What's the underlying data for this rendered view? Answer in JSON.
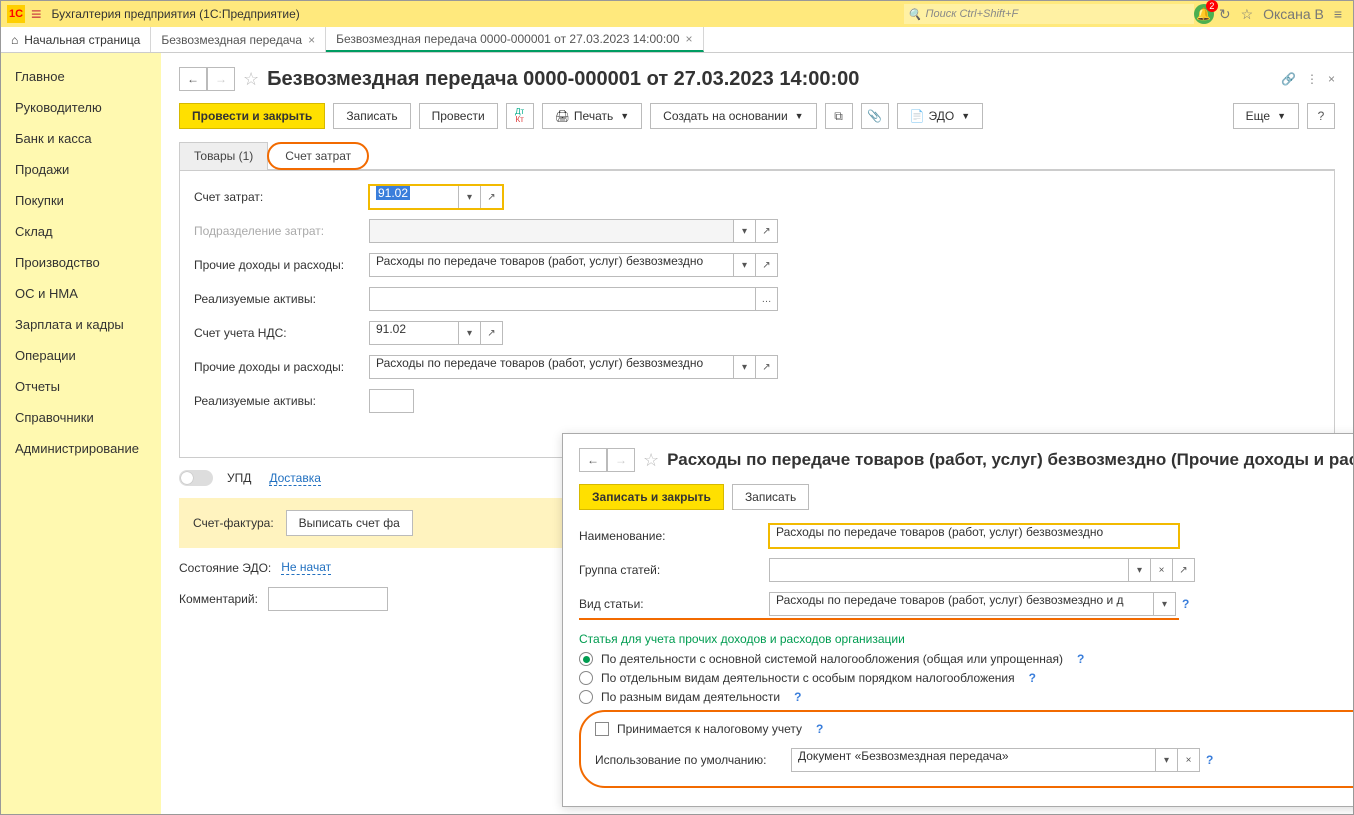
{
  "titlebar": {
    "app_title": "Бухгалтерия предприятия  (1С:Предприятие)",
    "search_placeholder": "Поиск Ctrl+Shift+F",
    "bell_badge": "2",
    "user": "Оксана В"
  },
  "tabs": {
    "home": "Начальная страница",
    "t1": "Безвозмездная передача",
    "t2": "Безвозмездная передача 0000-000001 от 27.03.2023 14:00:00"
  },
  "sidebar": {
    "items": [
      "Главное",
      "Руководителю",
      "Банк и касса",
      "Продажи",
      "Покупки",
      "Склад",
      "Производство",
      "ОС и НМА",
      "Зарплата и кадры",
      "Операции",
      "Отчеты",
      "Справочники",
      "Администрирование"
    ]
  },
  "docheader": {
    "title": "Безвозмездная передача 0000-000001 от 27.03.2023 14:00:00"
  },
  "toolbar": {
    "post_close": "Провести и закрыть",
    "save": "Записать",
    "post": "Провести",
    "print": "Печать",
    "create_based": "Создать на основании",
    "edo": "ЭДО",
    "more": "Еще",
    "help": "?"
  },
  "tabs2": {
    "goods": "Товары (1)",
    "cost": "Счет затрат"
  },
  "form": {
    "l_cost_acc": "Счет затрат:",
    "v_cost_acc": "91.02",
    "l_subdiv": "Подразделение затрат:",
    "l_other": "Прочие доходы и расходы:",
    "v_other": "Расходы по передаче товаров (работ, услуг) безвозмездно",
    "l_assets": "Реализуемые активы:",
    "l_nds": "Счет учета НДС:",
    "v_nds": "91.02"
  },
  "bottom": {
    "upd": "УПД",
    "delivery": "Доставка",
    "sf_label": "Счет-фактура:",
    "sf_btn": "Выписать счет фа",
    "edo_label": "Состояние ЭДО:",
    "edo_link": "Не начат",
    "comment": "Комментарий:"
  },
  "popup": {
    "title": "Расходы по передаче товаров (работ, услуг) безвозмездно (Прочие доходы и расходы)",
    "save_close": "Записать и закрыть",
    "save": "Записать",
    "l_name": "Наименование:",
    "v_name": "Расходы по передаче товаров (работ, услуг) безвозмездно",
    "l_group": "Группа статей:",
    "l_type": "Вид статьи:",
    "v_type": "Расходы по передаче товаров (работ, услуг) безвозмездно и д",
    "section": "Статья для учета прочих доходов и расходов организации",
    "r1": "По деятельности с основной системой налогообложения (общая или упрощенная)",
    "r2": "По отдельным видам деятельности с особым порядком налогообложения",
    "r3": "По разным видам деятельности",
    "chk": "Принимается к налоговому учету",
    "l_default": "Использование по умолчанию:",
    "v_default": "Документ «Безвозмездная передача»"
  }
}
